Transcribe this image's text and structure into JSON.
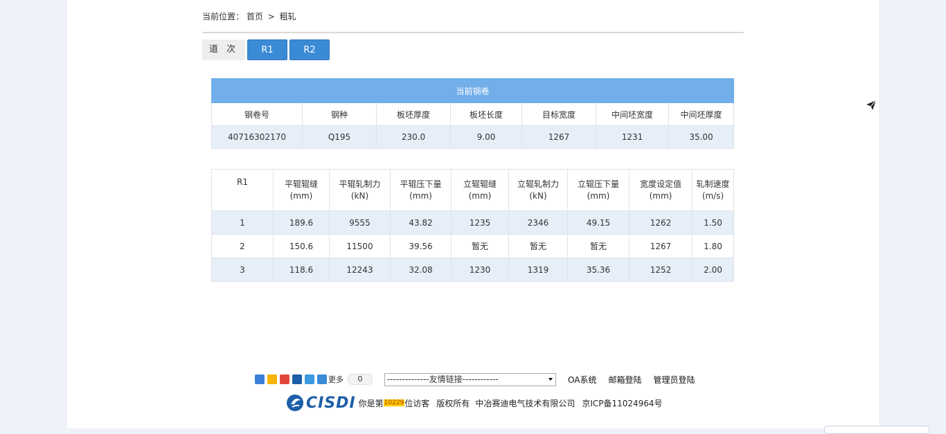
{
  "breadcrumb": {
    "prefix": "当前位置：",
    "home": "首页",
    "separator": ">",
    "current": "粗轧"
  },
  "pass_selector": {
    "label": "道 次",
    "buttons": [
      "R1",
      "R2"
    ]
  },
  "coil_table": {
    "title": "当前钢卷",
    "headers": [
      "钢卷号",
      "钢种",
      "板坯厚度",
      "板坯长度",
      "目标宽度",
      "中间坯宽度",
      "中间坯厚度"
    ],
    "values": [
      "40716302170",
      "Q195",
      "230.0",
      "9.00",
      "1267",
      "1231",
      "35.00"
    ]
  },
  "roll_table": {
    "headers": [
      [
        "R1",
        ""
      ],
      [
        "平辊辊缝",
        "(mm)"
      ],
      [
        "平辊轧制力",
        "(kN)"
      ],
      [
        "平辊压下量",
        "(mm)"
      ],
      [
        "立辊辊缝",
        "(mm)"
      ],
      [
        "立辊轧制力",
        "(kN)"
      ],
      [
        "立辊压下量",
        "(mm)"
      ],
      [
        "宽度设定值",
        "(mm)"
      ],
      [
        "轧制速度",
        "(m/s)"
      ]
    ],
    "rows": [
      [
        "1",
        "189.6",
        "9555",
        "43.82",
        "1235",
        "2346",
        "49.15",
        "1262",
        "1.50"
      ],
      [
        "2",
        "150.6",
        "11500",
        "39.56",
        "暂无",
        "暂无",
        "暂无",
        "1267",
        "1.80"
      ],
      [
        "3",
        "118.6",
        "12243",
        "32.08",
        "1230",
        "1319",
        "35.36",
        "1252",
        "2.00"
      ]
    ]
  },
  "footer": {
    "share_more": "更多",
    "share_count": "0",
    "links_select": "--------------友情链接------------",
    "links": [
      "OA系统",
      "邮箱登陆",
      "管理员登陆"
    ],
    "logo_text": "CISDI",
    "visitor_prefix": "你是第",
    "visitor_count": "10229",
    "visitor_suffix": "位访客",
    "copyright": "版权所有",
    "company": "中冶赛迪电气技术有限公司",
    "icp": "京ICP备11024964号"
  },
  "colors": {
    "header_blue": "#72aee9",
    "button_blue": "#3b8ad6",
    "row_alt": "#e6eef7",
    "brand": "#1d5fa8"
  }
}
